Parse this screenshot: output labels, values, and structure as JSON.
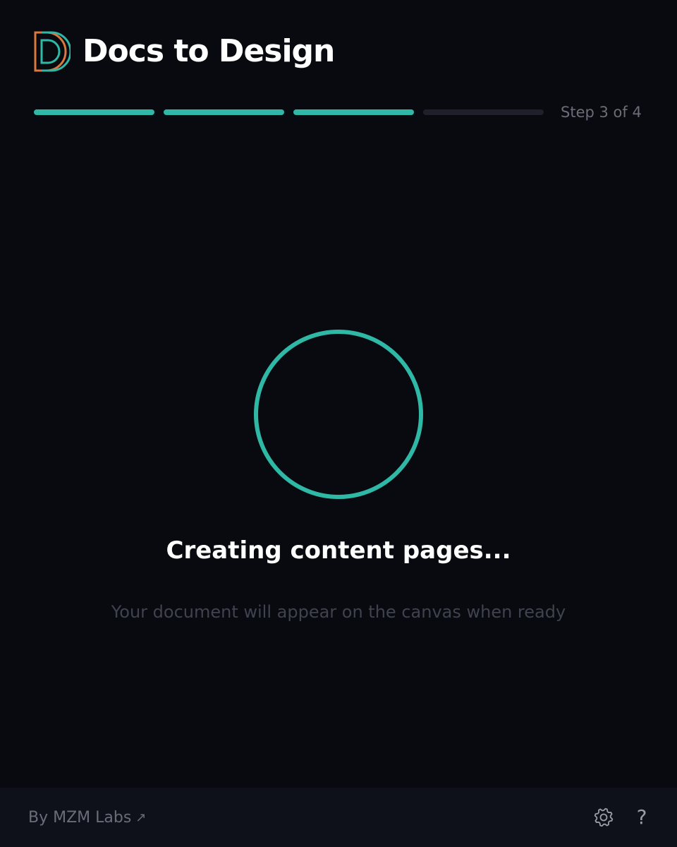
{
  "header": {
    "title": "Docs to Design",
    "logo_icon": "d-logo-icon"
  },
  "progress": {
    "current_step": 3,
    "total_steps": 4,
    "label": "Step 3 of 4",
    "complete_color": "#2fb8a6",
    "incomplete_color": "#1e202c"
  },
  "status": {
    "title": "Creating content pages...",
    "subtitle": "Your document will appear on the canvas when ready",
    "spinner_color": "#2fb8a6"
  },
  "footer": {
    "credit": "By MZM Labs",
    "credit_arrow": "↗",
    "settings_icon": "gear-icon",
    "help_label": "?"
  },
  "colors": {
    "background": "#080a0f",
    "footer_background": "#0f111a",
    "logo_orange": "#d9783f",
    "logo_teal": "#2fb8a6"
  }
}
